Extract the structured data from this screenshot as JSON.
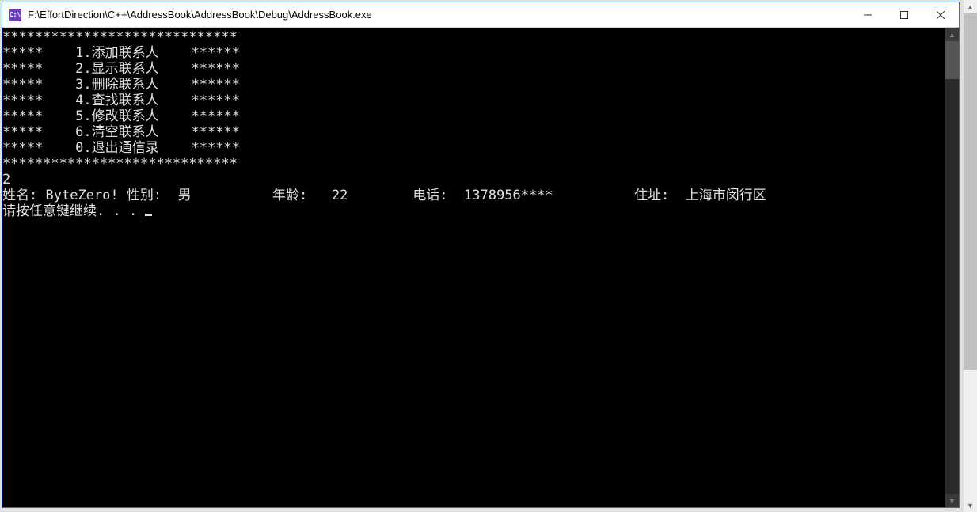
{
  "window": {
    "icon_label": "C:\\",
    "title": "F:\\EffortDirection\\C++\\AddressBook\\AddressBook\\Debug\\AddressBook.exe"
  },
  "console": {
    "border_top": "*****************************",
    "menu": [
      "*****    1.添加联系人    ******",
      "*****    2.显示联系人    ******",
      "*****    3.删除联系人    ******",
      "*****    4.查找联系人    ******",
      "*****    5.修改联系人    ******",
      "*****    6.清空联系人    ******",
      "*****    0.退出通信录    ******"
    ],
    "border_bottom": "*****************************",
    "input": "2",
    "record": {
      "name_label": "姓名:",
      "name_value": "ByteZero!",
      "gender_label": "性别:",
      "gender_value": "男",
      "age_label": "年龄:",
      "age_value": "22",
      "phone_label": "电话:",
      "phone_value": "1378956****",
      "addr_label": "住址:",
      "addr_value": "上海市闵行区"
    },
    "prompt": "请按任意键继续. . . "
  }
}
